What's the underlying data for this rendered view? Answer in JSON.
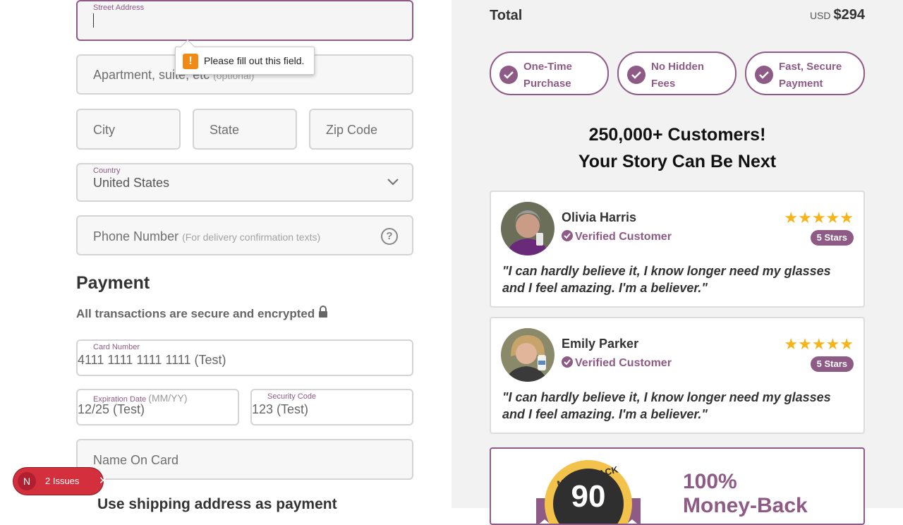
{
  "form": {
    "street": {
      "label": "Street Address"
    },
    "apartment": {
      "placeholder": "Apartment, suite, etc",
      "optional": "(optional)"
    },
    "city": {
      "placeholder": "City"
    },
    "state": {
      "placeholder": "State"
    },
    "zip": {
      "placeholder": "Zip Code"
    },
    "country": {
      "label": "Country",
      "value": "United States"
    },
    "phone": {
      "placeholder": "Phone Number",
      "hint": "(For delivery confirmation texts)"
    },
    "validation_message": "Please fill out this field."
  },
  "payment": {
    "heading": "Payment",
    "secure_text": "All transactions are secure and encrypted",
    "card_number": {
      "label": "Card Number",
      "value": "4111 1111 1111 1111 (Test)"
    },
    "expiration": {
      "label": "Expiration Date",
      "format": "(MM/YY)",
      "value": "12/25 (Test)"
    },
    "security_code": {
      "label": "Security Code",
      "value": "123 (Test)"
    },
    "name_on_card": {
      "placeholder": "Name On Card"
    },
    "shipping_checkbox_label": "Use shipping address as payment"
  },
  "issues_badge": {
    "logo": "N",
    "text": "2 Issues"
  },
  "summary": {
    "total_label": "Total",
    "currency": "USD",
    "total_value": "$294",
    "pills": [
      {
        "line1": "One-Time",
        "line2": "Purchase"
      },
      {
        "line1": "No Hidden",
        "line2": "Fees"
      },
      {
        "line1": "Fast, Secure",
        "line2": "Payment"
      }
    ],
    "customers_line1": "250,000+ Customers!",
    "customers_line2": "Your Story Can Be Next",
    "reviews": [
      {
        "name": "Olivia Harris",
        "verified": "Verified Customer",
        "stars": "★★★★★",
        "badge": "5 Stars",
        "quote": "\"I can hardly believe it, I know longer need my glasses and I feel amazing. I'm a believer.\""
      },
      {
        "name": "Emily Parker",
        "verified": "Verified Customer",
        "stars": "★★★★★",
        "badge": "5 Stars",
        "quote": "\"I can hardly believe it, I know longer need my glasses and I feel amazing. I'm a believer.\""
      }
    ],
    "guarantee": {
      "seal_top": "MONEY BACK",
      "seal_number": "90",
      "line1": "100%",
      "line2": "Money-Back"
    }
  },
  "colors": {
    "accent": "#8e5a86",
    "star": "#f5b41a",
    "issues": "#d32f3c"
  }
}
